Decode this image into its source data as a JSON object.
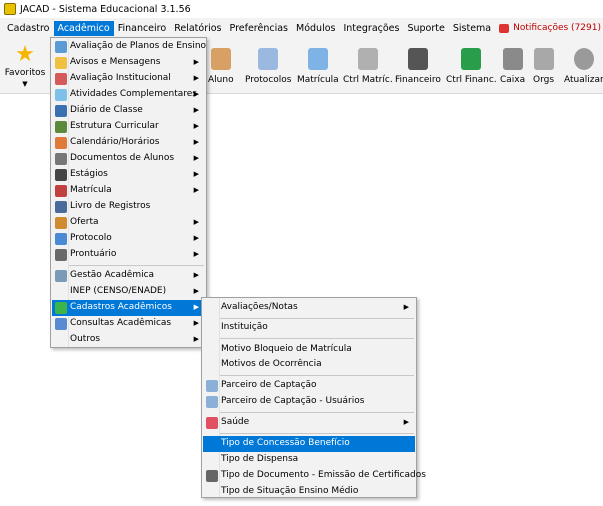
{
  "window": {
    "title": "JACAD - Sistema Educacional 3.1.56"
  },
  "menubar": {
    "items": [
      "Cadastro",
      "Acadêmico",
      "Financeiro",
      "Relatórios",
      "Preferências",
      "Módulos",
      "Integrações",
      "Suporte",
      "Sistema"
    ],
    "notifications": "Notificações (7291)"
  },
  "toolbar": {
    "favoritos": "Favoritos",
    "buttons": [
      "Aluno",
      "Protocolos",
      "Matrícula",
      "Ctrl Matríc.",
      "Financeiro",
      "Ctrl Financ.",
      "Caixa",
      "Orgs",
      "Atualizar"
    ]
  },
  "academico_menu": {
    "items": [
      "Avaliação de Planos de Ensino",
      "Avisos e Mensagens",
      "Avaliação Institucional",
      "Atividades Complementares",
      "Diário de Classe",
      "Estrutura Curricular",
      "Calendário/Horários",
      "Documentos de Alunos",
      "Estágios",
      "Matrícula",
      "Livro de Registros",
      "Oferta",
      "Protocolo",
      "Prontuário",
      "Gestão Acadêmica",
      "INEP (CENSO/ENADE)",
      "Cadastros Acadêmicos",
      "Consultas Acadêmicas",
      "Outros"
    ]
  },
  "cadastros_submenu": {
    "items": [
      "Avaliações/Notas",
      "Instituição",
      "Motivo Bloqueio de Matrícula",
      "Motivos de Ocorrência",
      "Parceiro de Captação",
      "Parceiro de Captação - Usuários",
      "Saúde",
      "Tipo de Concessão Benefício",
      "Tipo de Dispensa",
      "Tipo de Documento - Emissão de Certificados",
      "Tipo de Situação Ensino Médio"
    ]
  }
}
